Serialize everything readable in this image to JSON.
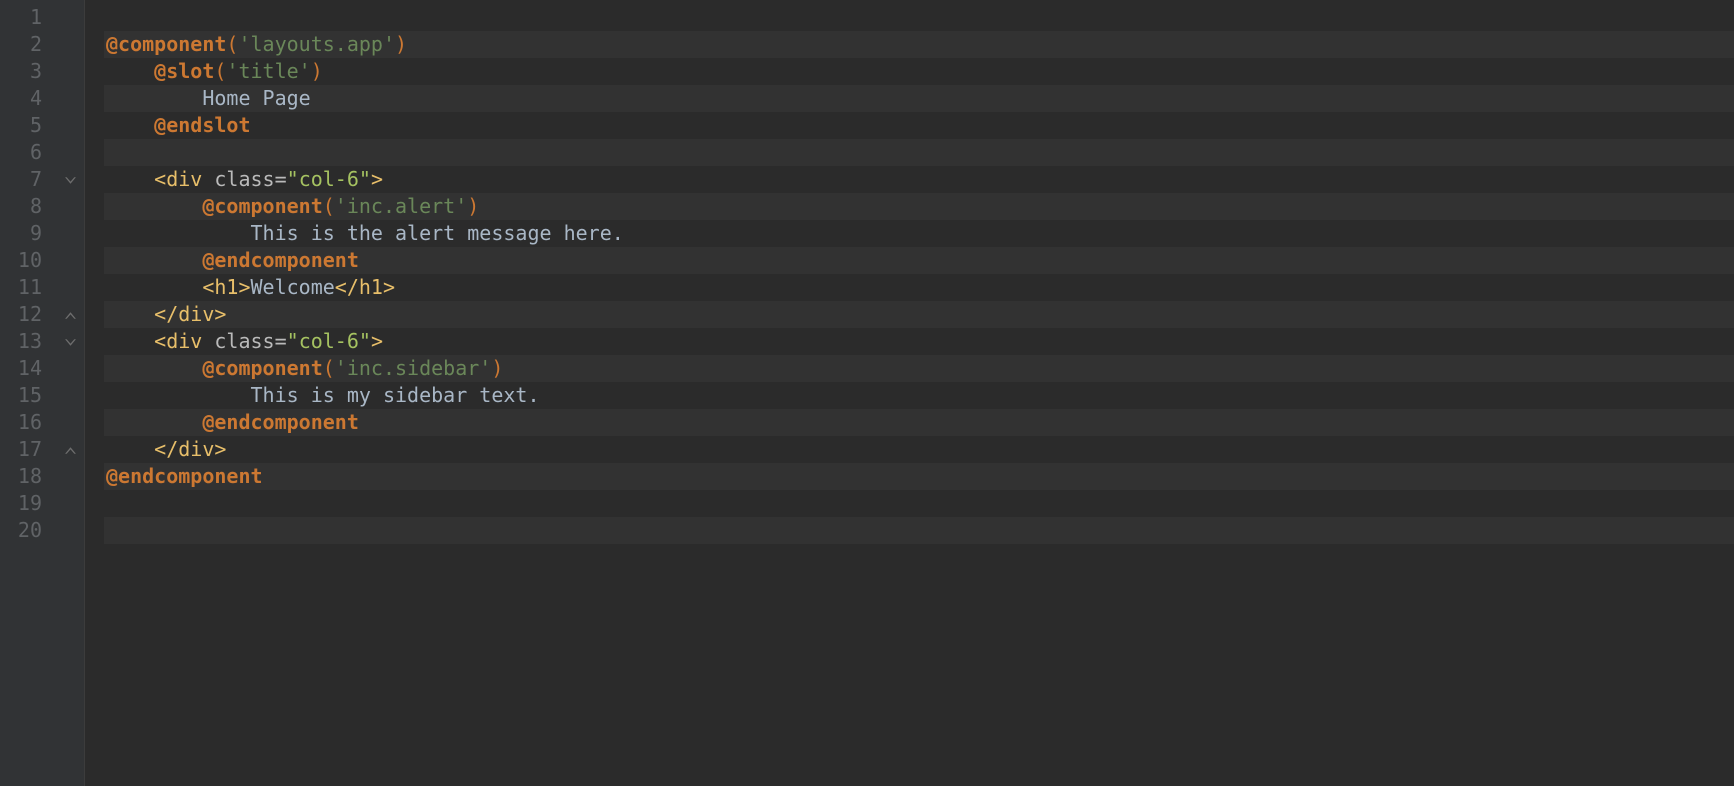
{
  "lineCount": 20,
  "foldMarkers": {
    "7": "down",
    "12": "up",
    "13": "down",
    "17": "up"
  },
  "code": {
    "l2": {
      "dir1": "@component",
      "p1": "(",
      "s1": "'layouts.app'",
      "p2": ")"
    },
    "l3": {
      "dir1": "@slot",
      "p1": "(",
      "s1": "'title'",
      "p2": ")"
    },
    "l4": {
      "txt": "Home Page"
    },
    "l5": {
      "dir1": "@endslot"
    },
    "l7": {
      "t1": "<div ",
      "attr": "class=",
      "q1": "\"",
      "val": "col-6",
      "q2": "\"",
      "t2": ">"
    },
    "l8": {
      "dir1": "@component",
      "p1": "(",
      "s1": "'inc.alert'",
      "p2": ")"
    },
    "l9": {
      "txt": "This is the alert message here."
    },
    "l10": {
      "dir1": "@endcomponent"
    },
    "l11": {
      "t1": "<h1>",
      "txt": "Welcome",
      "t2": "</h1>"
    },
    "l12": {
      "t1": "</div>"
    },
    "l13": {
      "t1": "<div ",
      "attr": "class=",
      "q1": "\"",
      "val": "col-6",
      "q2": "\"",
      "t2": ">"
    },
    "l14": {
      "dir1": "@component",
      "p1": "(",
      "s1": "'inc.sidebar'",
      "p2": ")"
    },
    "l15": {
      "txt": "This is my sidebar text."
    },
    "l16": {
      "dir1": "@endcomponent"
    },
    "l17": {
      "t1": "</div>"
    },
    "l18": {
      "dir1": "@endcomponent"
    }
  },
  "indent": {
    "1": 0,
    "2": 0,
    "3": 1,
    "4": 2,
    "5": 1,
    "6": 0,
    "7": 1,
    "8": 2,
    "9": 3,
    "10": 2,
    "11": 2,
    "12": 1,
    "13": 1,
    "14": 2,
    "15": 3,
    "16": 2,
    "17": 1,
    "18": 0,
    "19": 0,
    "20": 0
  },
  "altLines": [
    2,
    4,
    6,
    8,
    10,
    12,
    14,
    16,
    18,
    20
  ]
}
